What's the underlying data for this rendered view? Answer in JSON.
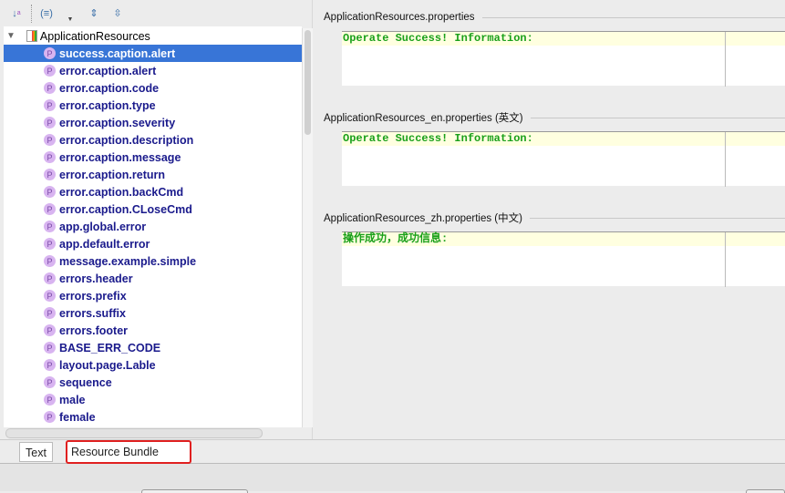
{
  "toolbar": {
    "icons": [
      "sort-alpha-icon",
      "group-icon",
      "expand-all-icon",
      "collapse-all-icon"
    ]
  },
  "tree": {
    "root": "ApplicationResources",
    "selected": "success.caption.alert",
    "items": [
      "success.caption.alert",
      "error.caption.alert",
      "error.caption.code",
      "error.caption.type",
      "error.caption.severity",
      "error.caption.description",
      "error.caption.message",
      "error.caption.return",
      "error.caption.backCmd",
      "error.caption.CLoseCmd",
      "app.global.error",
      "app.default.error",
      "message.example.simple",
      "errors.header",
      "errors.prefix",
      "errors.suffix",
      "errors.footer",
      "BASE_ERR_CODE",
      "layout.page.Lable",
      "sequence",
      "male",
      "female"
    ],
    "badge": "P"
  },
  "sections": [
    {
      "title": "ApplicationResources.properties",
      "value": "Operate Success! Information:"
    },
    {
      "title": "ApplicationResources_en.properties (英文)",
      "value": "Operate Success! Information:"
    },
    {
      "title": "ApplicationResources_zh.properties (中文)",
      "value": "操作成功，成功信息:"
    }
  ],
  "tabs": {
    "text": "Text",
    "bundle": "Resource Bundle",
    "active": "Resource Bundle",
    "highlight": "#e02020"
  }
}
